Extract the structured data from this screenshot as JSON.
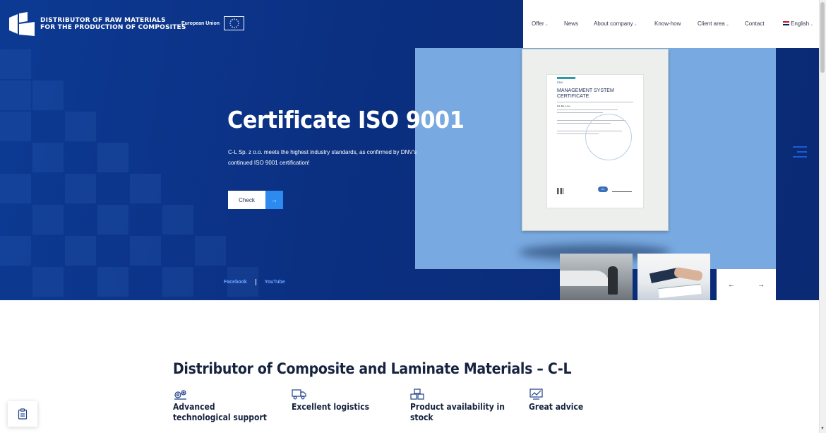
{
  "header": {
    "logo_line1": "DISTRIBUTOR OF RAW MATERIALS",
    "logo_line2": "FOR THE PRODUCTION OF COMPOSITES",
    "eu_label": "European Union"
  },
  "nav": {
    "items": [
      {
        "label": "Offer",
        "has_dropdown": true
      },
      {
        "label": "News",
        "has_dropdown": false
      },
      {
        "label": "About company",
        "has_dropdown": true
      },
      {
        "label": "Know-how",
        "has_dropdown": false
      },
      {
        "label": "Client area",
        "has_dropdown": true
      },
      {
        "label": "Contact",
        "has_dropdown": false
      }
    ],
    "language": "English"
  },
  "hero": {
    "title": "Certificate ISO 9001",
    "description": "C-L Sp. z o.o. meets the highest industry standards, as confirmed by DNV's continued ISO 9001 certification!",
    "cta_label": "Check",
    "cta_arrow": "→",
    "social": [
      "Facebook",
      "YouTube"
    ],
    "prev_arrow": "←",
    "next_arrow": "→"
  },
  "certificate": {
    "issuer": "DNV",
    "title_line1": "MANAGEMENT SYSTEM",
    "title_line2": "CERTIFICATE",
    "company": "C-L Sp. z o.o.",
    "badge": "IAF"
  },
  "section": {
    "title": "Distributor of Composite and Laminate Materials – C-L",
    "features": [
      {
        "icon": "gears-icon",
        "label": "Advanced technological support"
      },
      {
        "icon": "truck-icon",
        "label": "Excellent logistics"
      },
      {
        "icon": "boxes-icon",
        "label": "Product availability in stock"
      },
      {
        "icon": "chart-advice-icon",
        "label": "Great advice"
      }
    ]
  },
  "colors": {
    "hero_bg": "#0b2f80",
    "accent": "#2d8bf0",
    "cert_panel": "#78a9e0",
    "heading": "#16233e"
  }
}
